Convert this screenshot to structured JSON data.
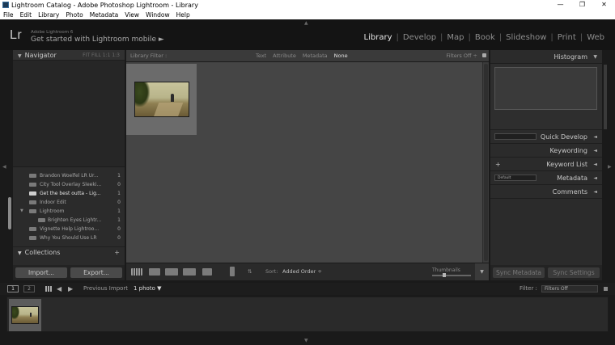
{
  "window": {
    "title": "Lightroom Catalog - Adobe Photoshop Lightroom - Library",
    "controls": [
      "—",
      "❐",
      "✕"
    ]
  },
  "menu": [
    "File",
    "Edit",
    "Library",
    "Photo",
    "Metadata",
    "View",
    "Window",
    "Help"
  ],
  "identity": {
    "logo": "Lr",
    "brand": "Adobe Lightroom 6",
    "mobile": "Get started with Lightroom mobile ►"
  },
  "modules": [
    {
      "label": "Library",
      "active": true
    },
    {
      "label": "Develop",
      "active": false
    },
    {
      "label": "Map",
      "active": false
    },
    {
      "label": "Book",
      "active": false
    },
    {
      "label": "Slideshow",
      "active": false
    },
    {
      "label": "Print",
      "active": false
    },
    {
      "label": "Web",
      "active": false
    }
  ],
  "left_panel": {
    "navigator_title": "Navigator",
    "navigator_zoom": "FIT  FILL  1:1  1:3",
    "folders": [
      {
        "label": "Brandon Woelfel LR Ur...",
        "count": "1",
        "selected": false,
        "indent": false
      },
      {
        "label": "City Tool Overlay Sleeki...",
        "count": "0",
        "selected": false,
        "indent": false
      },
      {
        "label": "Get the best outta - Lig...",
        "count": "1",
        "selected": true,
        "indent": false
      },
      {
        "label": "Indoor Edit",
        "count": "0",
        "selected": false,
        "indent": false
      },
      {
        "label": "Lightroom",
        "count": "1",
        "selected": false,
        "indent": false,
        "expanded": true
      },
      {
        "label": "Brighten Eyes Lightr...",
        "count": "1",
        "selected": false,
        "indent": true
      },
      {
        "label": "Vignette Help Lightroo...",
        "count": "0",
        "selected": false,
        "indent": false
      },
      {
        "label": "Why You Should Use LR",
        "count": "0",
        "selected": false,
        "indent": false
      }
    ],
    "collections_title": "Collections",
    "collections_plus": "+",
    "import_label": "Import...",
    "export_label": "Export..."
  },
  "filter_bar": {
    "label": "Library Filter :",
    "tabs": [
      {
        "label": "Text",
        "active": false
      },
      {
        "label": "Attribute",
        "active": false
      },
      {
        "label": "Metadata",
        "active": false
      },
      {
        "label": "None",
        "active": true
      }
    ],
    "filters_off": "Filters Off ÷"
  },
  "toolbar": {
    "sort_label": "Sort:",
    "sort_value": "Added Order ÷",
    "thumbnails_label": "Thumbnails",
    "thumbnails_level": 0.3,
    "menu_icon": "▼"
  },
  "right_panel": {
    "histogram": "Histogram",
    "quick_develop": "Quick Develop",
    "keywording": "Keywording",
    "keyword_list": "Keyword List",
    "keyword_plus": "+",
    "metadata": "Metadata",
    "metadata_preset": "Default",
    "comments": "Comments",
    "sync_metadata": "Sync Metadata",
    "sync_settings": "Sync Settings",
    "triangle": "◄",
    "histogram_triangle": "▼"
  },
  "filmstrip_bar": {
    "screen1": "1",
    "screen2": "2",
    "source": "Previous Import",
    "count": "1 photo ▼",
    "filter_label": "Filter :",
    "filter_value": "Filters Off"
  },
  "colors": {
    "accent_text": "#e6e6e6",
    "panel_bg": "#2b2b2b",
    "grid_bg": "#454545"
  }
}
